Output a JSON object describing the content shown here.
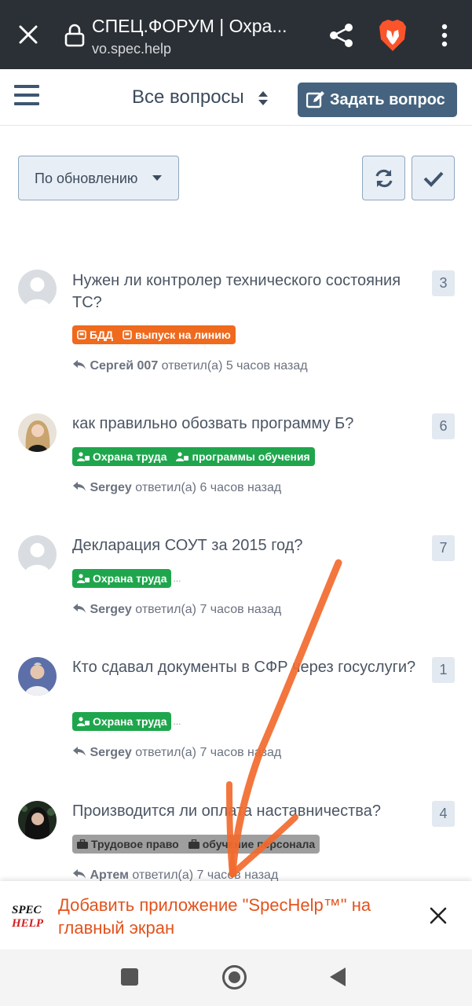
{
  "browser": {
    "title": "СПЕЦ.ФОРУМ | Охра...",
    "url": "vo.spec.help"
  },
  "header": {
    "nav_label": "Все вопросы",
    "ask_button": "Задать вопрос"
  },
  "toolbar": {
    "order_label": "По обновлению"
  },
  "questions": [
    {
      "title": "Нужен ли контролер технического состояния ТС?",
      "count": "3",
      "tags": [
        "БДД",
        "выпуск на линию"
      ],
      "tag_color": "#ef6a1d",
      "author": "Сергей 007",
      "action": "ответил(а) 5 часов назад"
    },
    {
      "title": "как правильно обозвать программу Б?",
      "count": "6",
      "tags": [
        "Охрана труда",
        "программы обучения"
      ],
      "tag_color": "#1fa64d",
      "author": "Sergey",
      "action": "ответил(а) 6 часов назад"
    },
    {
      "title": "Декларация СОУТ за 2015 год?",
      "count": "7",
      "tags": [
        "Охрана труда"
      ],
      "tag_color": "#1fa64d",
      "author": "Sergey",
      "action": "ответил(а) 7 часов назад"
    },
    {
      "title": "Кто сдавал документы в СФР через госуслуги?",
      "count": "1",
      "tags": [
        "Охрана труда"
      ],
      "tag_color": "#1fa64d",
      "author": "Sergey",
      "action": "ответил(а) 7 часов назад"
    },
    {
      "title": "Производится ли оплата наставничества?",
      "count": "4",
      "tags": [
        "Трудовое право",
        "обучение персонала"
      ],
      "tag_color": "#9e9e9e",
      "author": "Артем",
      "action": "ответил(а) 7 часов назад"
    }
  ],
  "install_banner": {
    "logo_text": "SPEC HELP",
    "text": "Добавить приложение \"SpecHelp™\" на главный экран"
  },
  "colors": {
    "browser_bar": "#2b3036",
    "ask_button": "#45637f",
    "banner_text": "#e2531d",
    "annotation_arrow": "#f26a2e"
  },
  "icons": [
    "close-icon",
    "lock-icon",
    "share-icon",
    "brave-lion-icon",
    "kebab-menu-icon",
    "hamburger-icon",
    "sort-caret-icon",
    "edit-icon",
    "caret-down-icon",
    "refresh-icon",
    "check-icon",
    "reply-icon",
    "tag-icon",
    "users-icon",
    "briefcase-icon",
    "close-x-icon",
    "nav-recent-icon",
    "nav-home-icon",
    "nav-back-icon"
  ]
}
